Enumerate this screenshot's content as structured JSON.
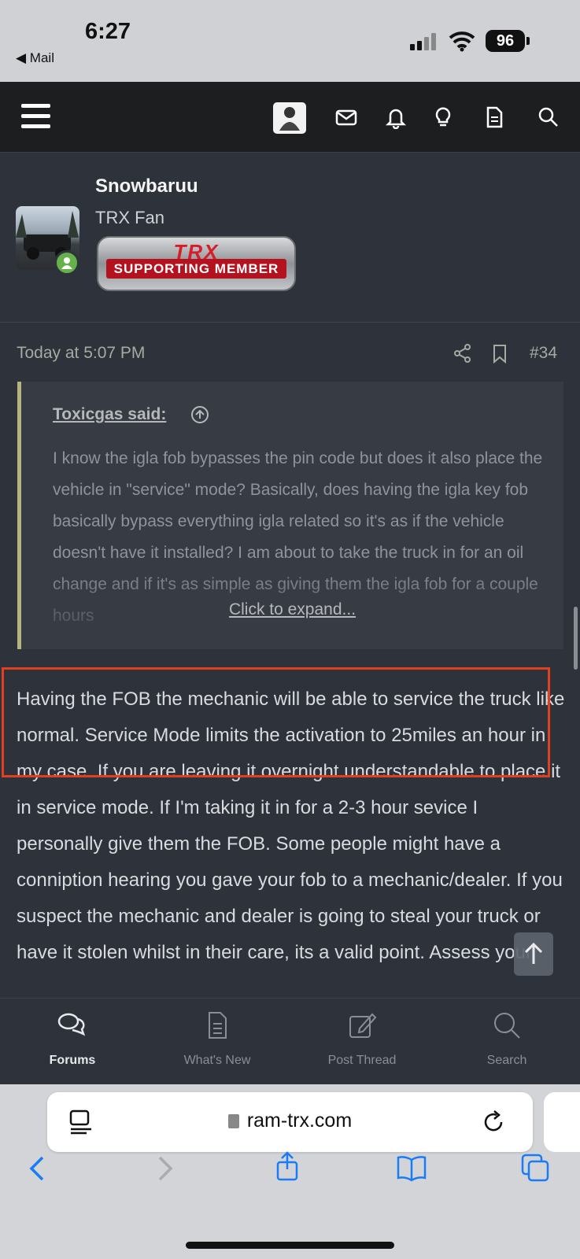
{
  "status": {
    "time": "6:27",
    "back_label": "◀ Mail",
    "battery": "96"
  },
  "topnav": {
    "icons": [
      "menu-icon",
      "user-avatar",
      "mail-icon",
      "bell-icon",
      "lightbulb-icon",
      "document-icon",
      "search-icon"
    ]
  },
  "user": {
    "name": "Snowbaruu",
    "title": "TRX Fan",
    "badge_logo": "TRX",
    "badge_text": "SUPPORTING MEMBER"
  },
  "post": {
    "time": "Today at 5:07 PM",
    "number": "#34",
    "quote_author": "Toxicgas said:",
    "quote_text": "I know the igla fob bypasses the pin code but does it also place the vehicle in \"service\" mode? Basically, does having the igla key fob basically bypass everything igla related so it's as if the vehicle doesn't have it installed? I am about to take the truck in for an oil change and if it's as simple as giving them the igla fob for a couple hours",
    "expand_label": "Click to expand...",
    "body": "Having the FOB the mechanic will be able to service the truck like normal. Service Mode limits the activation to 25miles an hour in my case. If you are leaving it overnight understandable to place it in service mode. If I'm taking it in for a 2-3 hour sevice I personally give them the FOB. Some people might have a conniption hearing you gave your fob to a mechanic/dealer. If you suspect the mechanic and dealer is going to steal your truck or have it stolen whilst in their care, its a valid point. Assess your"
  },
  "tabs": [
    {
      "label": "Forums",
      "icon": "chat-bubbles-icon",
      "active": true
    },
    {
      "label": "What's New",
      "icon": "document-icon",
      "active": false
    },
    {
      "label": "Post Thread",
      "icon": "edit-icon",
      "active": false
    },
    {
      "label": "Search",
      "icon": "search-icon",
      "active": false
    }
  ],
  "browser": {
    "url": "ram-trx.com"
  },
  "colors": {
    "bg": "#2d323b",
    "highlight_box": "#e0401f",
    "safari_blue": "#1a7cf5",
    "quote_border": "#b4b57f"
  }
}
